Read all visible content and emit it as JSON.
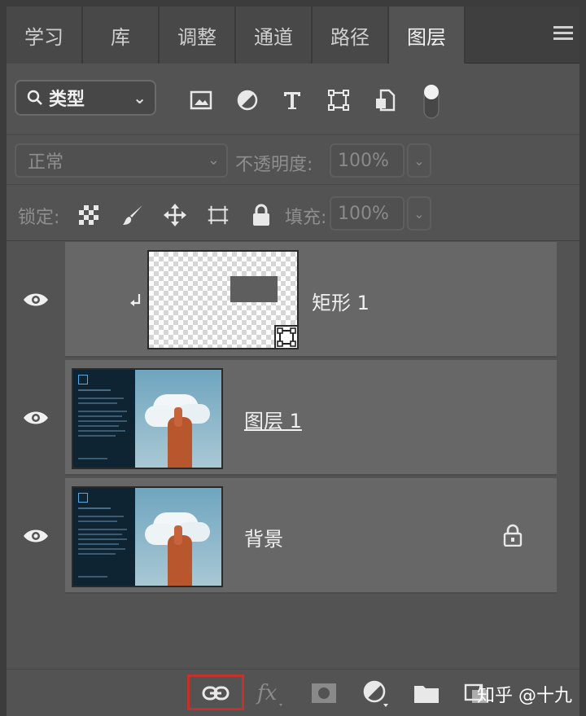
{
  "tabs": [
    {
      "label": "学习"
    },
    {
      "label": "库"
    },
    {
      "label": "调整"
    },
    {
      "label": "通道"
    },
    {
      "label": "路径"
    },
    {
      "label": "图层"
    }
  ],
  "active_tab": "图层",
  "filter": {
    "kind_label": "类型",
    "icons": [
      "image-filter-icon",
      "adjustment-filter-icon",
      "type-filter-icon",
      "shape-filter-icon",
      "smart-object-filter-icon",
      "filter-toggle-icon"
    ]
  },
  "blend": {
    "mode": "正常",
    "opacity_label": "不透明度:",
    "opacity_value": "100%"
  },
  "lock": {
    "label": "锁定:",
    "fill_label": "填充:",
    "fill_value": "100%"
  },
  "layers": [
    {
      "name": "矩形 1",
      "type": "shape",
      "clipped": true,
      "visible": true
    },
    {
      "name": "图层 1",
      "type": "pixel",
      "visible": true
    },
    {
      "name": "背景",
      "type": "background",
      "locked": true,
      "visible": true
    }
  ],
  "watermark": "知乎 @十九",
  "accent_color": "#c8302a"
}
